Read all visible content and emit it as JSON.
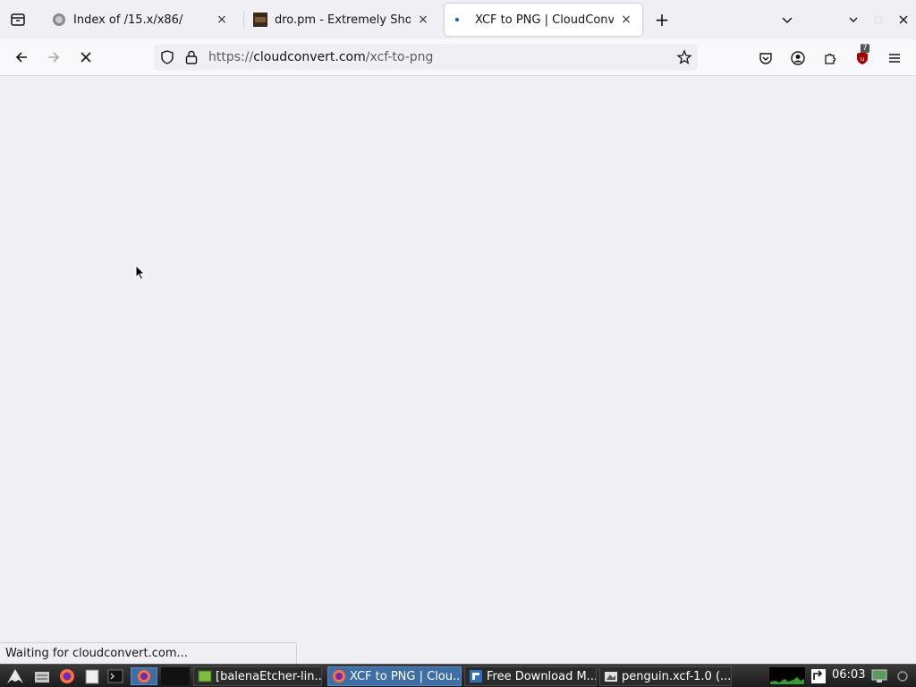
{
  "browser": {
    "tabs": [
      {
        "title": "Index of /15.x/x86/",
        "active": false
      },
      {
        "title": "dro.pm - Extremely Short URL",
        "active": false
      },
      {
        "title": "XCF to PNG | CloudConvert",
        "active": true
      }
    ],
    "close_glyph": "×",
    "new_tab_glyph": "+",
    "url": {
      "scheme": "https://",
      "host": "cloudconvert.com",
      "path": "/xcf-to-png"
    },
    "extension_badge": "7",
    "status_text": "Waiting for cloudconvert.com..."
  },
  "taskbar": {
    "windows": [
      {
        "label": "[balenaEtcher-lin...",
        "active": false
      },
      {
        "label": "XCF to PNG | Clou...",
        "active": true
      },
      {
        "label": "Free Download M...",
        "active": false
      },
      {
        "label": "penguin.xcf-1.0 (...",
        "active": false
      }
    ],
    "clock": "06:03"
  },
  "colors": {
    "accent": "#0060df",
    "taskbar_active": "#3d6ea5",
    "ublock_red": "#a00000"
  }
}
